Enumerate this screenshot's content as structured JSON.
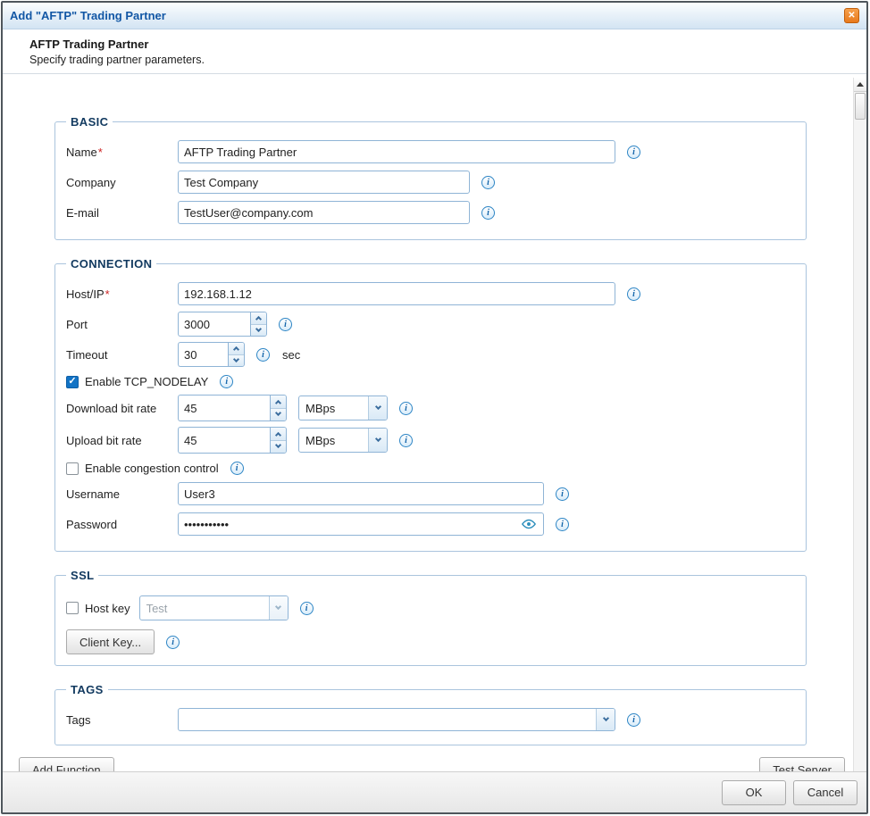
{
  "titlebar": {
    "title": "Add \"AFTP\" Trading Partner"
  },
  "icons": {
    "close": "✕",
    "check": "✓",
    "info": "i"
  },
  "header": {
    "title": "AFTP Trading Partner",
    "subtitle": "Specify trading partner parameters."
  },
  "basic": {
    "legend": "BASIC",
    "name_label": "Name",
    "name_required": "*",
    "name_value": "AFTP Trading Partner",
    "company_label": "Company",
    "company_value": "Test Company",
    "email_label": "E-mail",
    "email_value": "TestUser@company.com"
  },
  "connection": {
    "legend": "CONNECTION",
    "host_label": "Host/IP",
    "host_required": "*",
    "host_value": "192.168.1.12",
    "port_label": "Port",
    "port_value": "3000",
    "timeout_label": "Timeout",
    "timeout_value": "30",
    "timeout_unit": "sec",
    "tcp_nodelay_label": "Enable TCP_NODELAY",
    "download_label": "Download bit rate",
    "download_value": "45",
    "download_unit": "MBps",
    "upload_label": "Upload bit rate",
    "upload_value": "45",
    "upload_unit": "MBps",
    "congestion_label": "Enable congestion control",
    "username_label": "Username",
    "username_value": "User3",
    "password_label": "Password",
    "password_value": "•••••••••••"
  },
  "ssl": {
    "legend": "SSL",
    "hostkey_label": "Host key",
    "hostkey_value": "Test",
    "clientkey_button": "Client Key..."
  },
  "tags": {
    "legend": "TAGS",
    "tags_label": "Tags",
    "tags_value": ""
  },
  "buttons": {
    "add_function": "Add Function",
    "test_server": "Test Server",
    "ok": "OK",
    "cancel": "Cancel"
  }
}
